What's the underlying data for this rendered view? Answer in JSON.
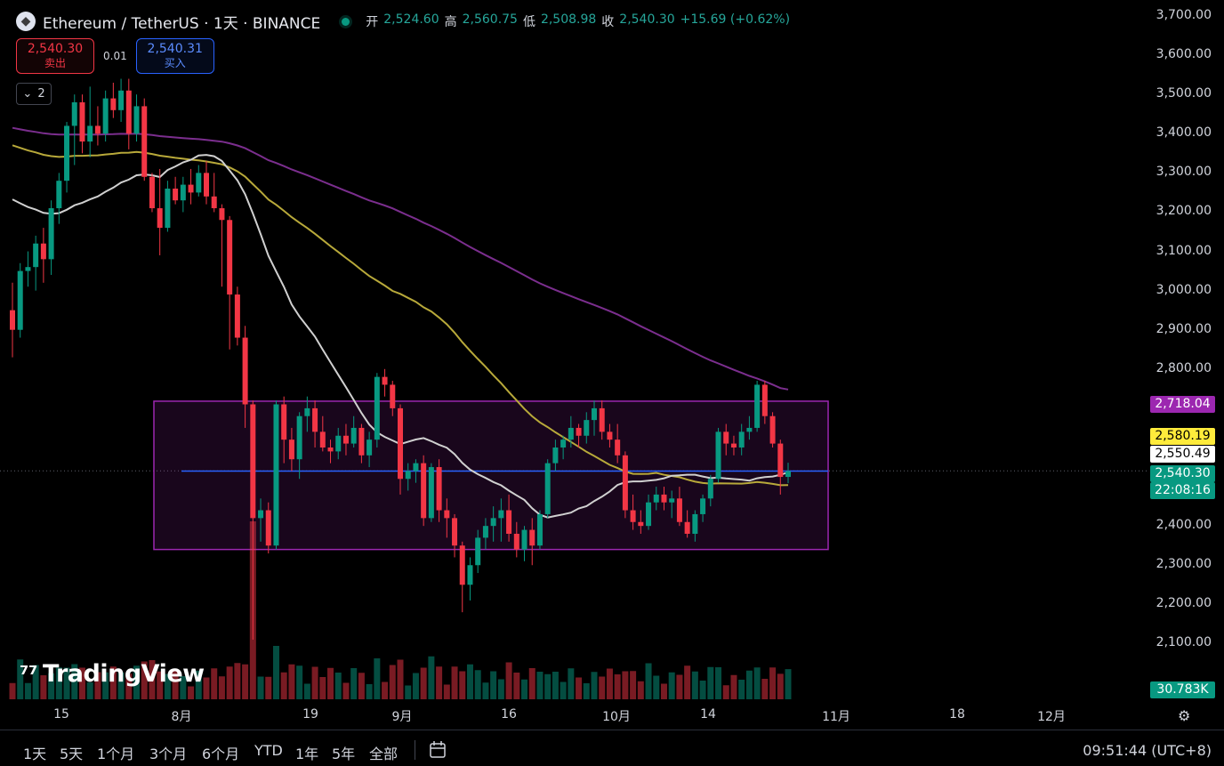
{
  "header": {
    "symbol_title": "Ethereum / TetherUS · 1天 · BINANCE",
    "ohlc": [
      {
        "k": "开",
        "v": "2,524.60"
      },
      {
        "k": "高",
        "v": "2,560.75"
      },
      {
        "k": "低",
        "v": "2,508.98"
      },
      {
        "k": "收",
        "v": "2,540.30"
      }
    ],
    "change": "+15.69 (+0.62%)"
  },
  "trade": {
    "sell_price": "2,540.30",
    "sell_label": "卖出",
    "spread": "0.01",
    "buy_price": "2,540.31",
    "buy_label": "买入"
  },
  "indicators_toggle": {
    "count": "2",
    "icon": "chevron-down-icon"
  },
  "watermark": "TradingView",
  "price_axis": {
    "ticks": [
      "3,700.00",
      "3,600.00",
      "3,500.00",
      "3,400.00",
      "3,300.00",
      "3,200.00",
      "3,100.00",
      "3,000.00",
      "2,900.00",
      "2,800.00",
      "2,400.00",
      "2,300.00",
      "2,200.00",
      "2,100.00"
    ],
    "tags": [
      {
        "value": "2,718.04",
        "bg": "#9c27b0",
        "color": "#ffffff"
      },
      {
        "value": "2,580.19",
        "bg": "#ffeb3b",
        "color": "#000000"
      },
      {
        "value": "2,550.49",
        "bg": "#ffffff",
        "color": "#000000"
      },
      {
        "value": "2,540.30",
        "bg": "#089981",
        "color": "#ffffff"
      },
      {
        "value": "22:08:16",
        "bg": "#089981",
        "color": "#ffffff"
      },
      {
        "value": "30.783K",
        "bg": "#089981",
        "color": "#ffffff"
      }
    ]
  },
  "time_axis": [
    "15",
    "8月",
    "19",
    "9月",
    "16",
    "10月",
    "14",
    "11月",
    "18",
    "12月"
  ],
  "bottom_bar": {
    "ranges": [
      "1天",
      "5天",
      "1个月",
      "3个月",
      "6个月",
      "YTD",
      "1年",
      "5年",
      "全部"
    ],
    "clock": "09:51:44 (UTC+8)"
  },
  "colors": {
    "up": "#089981",
    "down": "#f23645",
    "ma_fast": "#d0d0d0",
    "ma_mid": "#b8a93a",
    "ma_slow": "#7b2e8e",
    "range_box": "#9c27b0",
    "level_line": "#2962ff"
  },
  "chart_data": {
    "type": "candlestick",
    "symbol": "ETHUSDT",
    "interval": "1D",
    "ylim": [
      2050,
      3750
    ],
    "candles": [
      [
        2950,
        3020,
        2830,
        2900
      ],
      [
        2900,
        3070,
        2880,
        3050
      ],
      [
        3050,
        3100,
        3010,
        3060
      ],
      [
        3060,
        3140,
        3000,
        3120
      ],
      [
        3120,
        3160,
        3020,
        3080
      ],
      [
        3080,
        3230,
        3040,
        3210
      ],
      [
        3210,
        3300,
        3170,
        3280
      ],
      [
        3280,
        3430,
        3250,
        3420
      ],
      [
        3420,
        3500,
        3320,
        3480
      ],
      [
        3480,
        3500,
        3350,
        3380
      ],
      [
        3380,
        3520,
        3340,
        3420
      ],
      [
        3420,
        3470,
        3370,
        3400
      ],
      [
        3400,
        3510,
        3380,
        3490
      ],
      [
        3490,
        3530,
        3440,
        3460
      ],
      [
        3460,
        3540,
        3430,
        3510
      ],
      [
        3510,
        3540,
        3360,
        3400
      ],
      [
        3400,
        3500,
        3380,
        3470
      ],
      [
        3470,
        3490,
        3280,
        3290
      ],
      [
        3290,
        3300,
        3200,
        3210
      ],
      [
        3210,
        3310,
        3090,
        3160
      ],
      [
        3160,
        3280,
        3150,
        3260
      ],
      [
        3260,
        3290,
        3220,
        3230
      ],
      [
        3230,
        3290,
        3200,
        3270
      ],
      [
        3270,
        3310,
        3220,
        3250
      ],
      [
        3250,
        3320,
        3240,
        3300
      ],
      [
        3300,
        3330,
        3220,
        3240
      ],
      [
        3240,
        3300,
        3200,
        3210
      ],
      [
        3210,
        3220,
        3010,
        3180
      ],
      [
        3180,
        3190,
        2850,
        2990
      ],
      [
        2990,
        3010,
        2860,
        2880
      ],
      [
        2880,
        2910,
        2650,
        2710
      ],
      [
        2710,
        2720,
        2110,
        2420
      ],
      [
        2420,
        2470,
        2360,
        2440
      ],
      [
        2440,
        2460,
        2330,
        2350
      ],
      [
        2350,
        2720,
        2340,
        2710
      ],
      [
        2710,
        2730,
        2560,
        2620
      ],
      [
        2620,
        2650,
        2540,
        2570
      ],
      [
        2570,
        2690,
        2520,
        2680
      ],
      [
        2680,
        2730,
        2640,
        2700
      ],
      [
        2700,
        2720,
        2600,
        2640
      ],
      [
        2640,
        2680,
        2590,
        2600
      ],
      [
        2600,
        2620,
        2560,
        2590
      ],
      [
        2590,
        2650,
        2570,
        2630
      ],
      [
        2630,
        2660,
        2580,
        2610
      ],
      [
        2610,
        2680,
        2600,
        2650
      ],
      [
        2650,
        2660,
        2560,
        2580
      ],
      [
        2580,
        2640,
        2550,
        2620
      ],
      [
        2620,
        2790,
        2600,
        2780
      ],
      [
        2780,
        2800,
        2730,
        2760
      ],
      [
        2760,
        2770,
        2680,
        2700
      ],
      [
        2700,
        2710,
        2480,
        2520
      ],
      [
        2520,
        2560,
        2490,
        2540
      ],
      [
        2540,
        2570,
        2510,
        2560
      ],
      [
        2560,
        2580,
        2400,
        2420
      ],
      [
        2420,
        2560,
        2410,
        2550
      ],
      [
        2550,
        2570,
        2410,
        2440
      ],
      [
        2440,
        2470,
        2370,
        2420
      ],
      [
        2420,
        2430,
        2320,
        2350
      ],
      [
        2350,
        2360,
        2180,
        2250
      ],
      [
        2250,
        2320,
        2210,
        2300
      ],
      [
        2300,
        2390,
        2280,
        2370
      ],
      [
        2370,
        2420,
        2340,
        2400
      ],
      [
        2400,
        2450,
        2360,
        2420
      ],
      [
        2420,
        2470,
        2360,
        2440
      ],
      [
        2440,
        2480,
        2360,
        2380
      ],
      [
        2380,
        2410,
        2320,
        2340
      ],
      [
        2340,
        2400,
        2310,
        2390
      ],
      [
        2390,
        2420,
        2300,
        2350
      ],
      [
        2350,
        2440,
        2340,
        2430
      ],
      [
        2430,
        2570,
        2420,
        2560
      ],
      [
        2560,
        2620,
        2540,
        2600
      ],
      [
        2600,
        2630,
        2570,
        2620
      ],
      [
        2620,
        2680,
        2600,
        2650
      ],
      [
        2650,
        2660,
        2600,
        2630
      ],
      [
        2630,
        2690,
        2610,
        2670
      ],
      [
        2670,
        2720,
        2630,
        2700
      ],
      [
        2700,
        2720,
        2620,
        2640
      ],
      [
        2640,
        2660,
        2600,
        2620
      ],
      [
        2620,
        2660,
        2560,
        2580
      ],
      [
        2580,
        2590,
        2420,
        2440
      ],
      [
        2440,
        2480,
        2390,
        2410
      ],
      [
        2410,
        2440,
        2380,
        2400
      ],
      [
        2400,
        2480,
        2390,
        2460
      ],
      [
        2460,
        2500,
        2440,
        2480
      ],
      [
        2480,
        2500,
        2440,
        2460
      ],
      [
        2460,
        2490,
        2420,
        2470
      ],
      [
        2470,
        2500,
        2400,
        2410
      ],
      [
        2410,
        2440,
        2370,
        2380
      ],
      [
        2380,
        2440,
        2360,
        2430
      ],
      [
        2430,
        2480,
        2410,
        2470
      ],
      [
        2470,
        2530,
        2450,
        2520
      ],
      [
        2520,
        2650,
        2510,
        2640
      ],
      [
        2640,
        2660,
        2580,
        2610
      ],
      [
        2610,
        2630,
        2580,
        2600
      ],
      [
        2600,
        2660,
        2580,
        2640
      ],
      [
        2640,
        2680,
        2620,
        2650
      ],
      [
        2650,
        2770,
        2640,
        2760
      ],
      [
        2760,
        2770,
        2660,
        2680
      ],
      [
        2680,
        2690,
        2600,
        2610
      ],
      [
        2610,
        2620,
        2480,
        2525
      ],
      [
        2525,
        2561,
        2509,
        2540
      ]
    ],
    "ma_fast_series": "derived 20-day moving average",
    "ma_mid_series": "derived 50-day moving average",
    "ma_slow_series": "derived 100-day moving average",
    "range_box": {
      "top": 2718.04,
      "bottom": 2340
    },
    "level_line": 2540,
    "last_price": 2540.3
  }
}
